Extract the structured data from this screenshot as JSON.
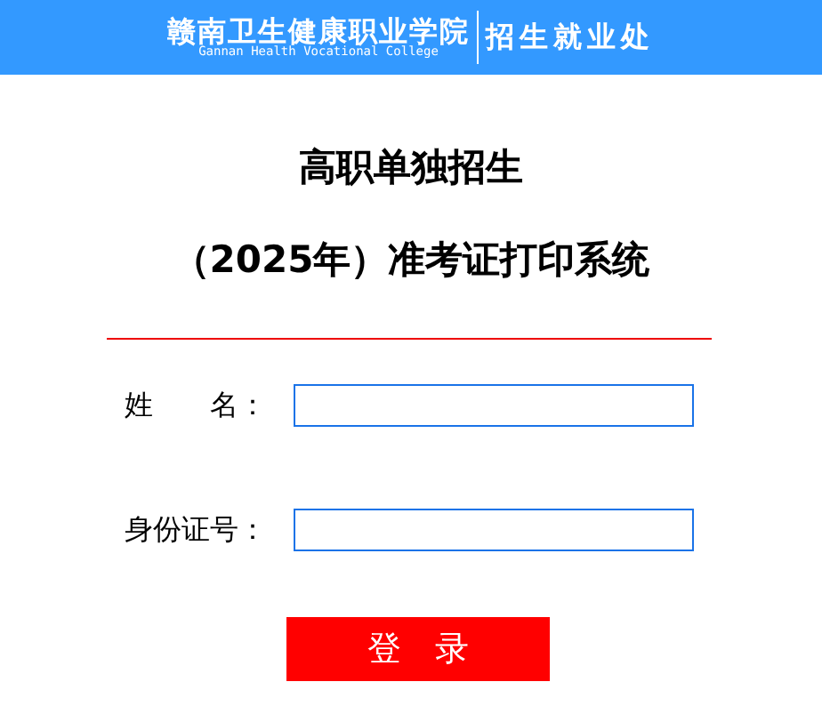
{
  "header": {
    "school_name": "赣南卫生健康职业学院",
    "school_name_en": "Gannan Health Vocational College",
    "department": "招生就业处"
  },
  "title_lines": [
    "高职单独招生",
    "（2025年）准考证打印系统"
  ],
  "fields": [
    {
      "label": "姓　　名："
    },
    {
      "label": "身份证号："
    }
  ],
  "login_button": "登　录"
}
